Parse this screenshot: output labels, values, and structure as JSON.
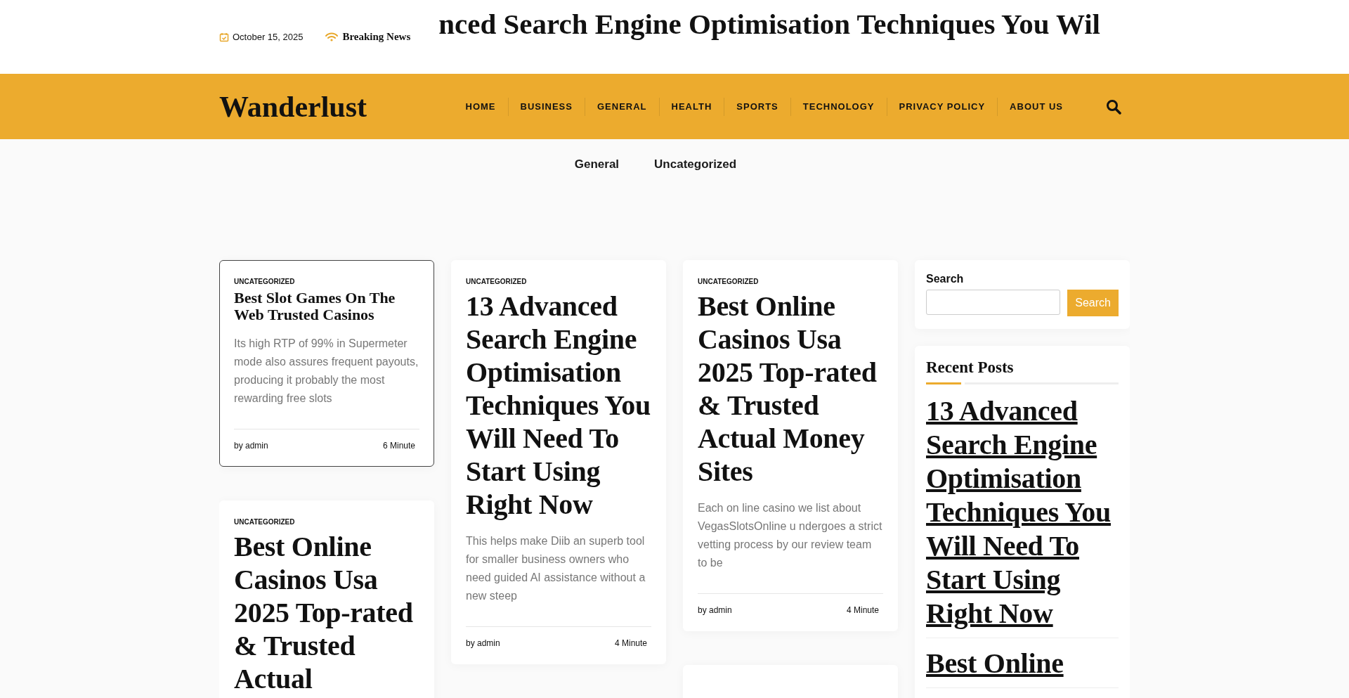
{
  "top_bar": {
    "date": "October 15, 2025",
    "breaking_label": "Breaking News",
    "ticker": "nced Search Engine Optimisation Techniques You Wil"
  },
  "header": {
    "logo": "Wanderlust",
    "nav": [
      {
        "label": "HOME"
      },
      {
        "label": "BUSINESS"
      },
      {
        "label": "GENERAL"
      },
      {
        "label": "HEALTH"
      },
      {
        "label": "SPORTS"
      },
      {
        "label": "TECHNOLOGY"
      },
      {
        "label": "PRIVACY POLICY"
      },
      {
        "label": "ABOUT US"
      }
    ]
  },
  "categories": [
    "General",
    "Uncategorized"
  ],
  "columns": [
    [
      {
        "kind": "compact",
        "outlined": true,
        "category": "UNCATEGORIZED",
        "title": "Best Slot Games On The Web Trusted Casinos",
        "excerpt": "Its high RTP of 99% in Supermeter mode also assures frequent payouts, producing it probably the most rewarding free slots",
        "author": "by admin",
        "read_time": "6 Minute"
      },
      {
        "kind": "feature",
        "outlined": false,
        "category": "UNCATEGORIZED",
        "title": "Best Online Casinos Usa 2025 Top-rated & Trusted Actual"
      }
    ],
    [
      {
        "kind": "feature",
        "outlined": false,
        "category": "UNCATEGORIZED",
        "title": "13 Advanced Search Engine Optimisation Techniques You Will Need To Start Using Right Now",
        "excerpt": "This helps make Diib an superb tool for smaller business owners who need guided AI assistance without a new steep",
        "author": "by admin",
        "read_time": "4 Minute"
      }
    ],
    [
      {
        "kind": "feature",
        "outlined": false,
        "category": "UNCATEGORIZED",
        "title": "Best Online Casinos Usa 2025 Top-rated & Trusted Actual Money Sites",
        "excerpt": "Each on line casino we list about VegasSlotsOnline u ndergoes a strict vetting process by our review team to be",
        "author": "by admin",
        "read_time": "4 Minute"
      },
      {
        "kind": "stub"
      }
    ]
  ],
  "sidebar": {
    "search": {
      "label": "Search",
      "button": "Search"
    },
    "recent": {
      "title": "Recent Posts",
      "posts": [
        "13 Advanced Search Engine Optimisation Techniques You Will Need To Start Using Right Now",
        "Best Online"
      ]
    }
  }
}
